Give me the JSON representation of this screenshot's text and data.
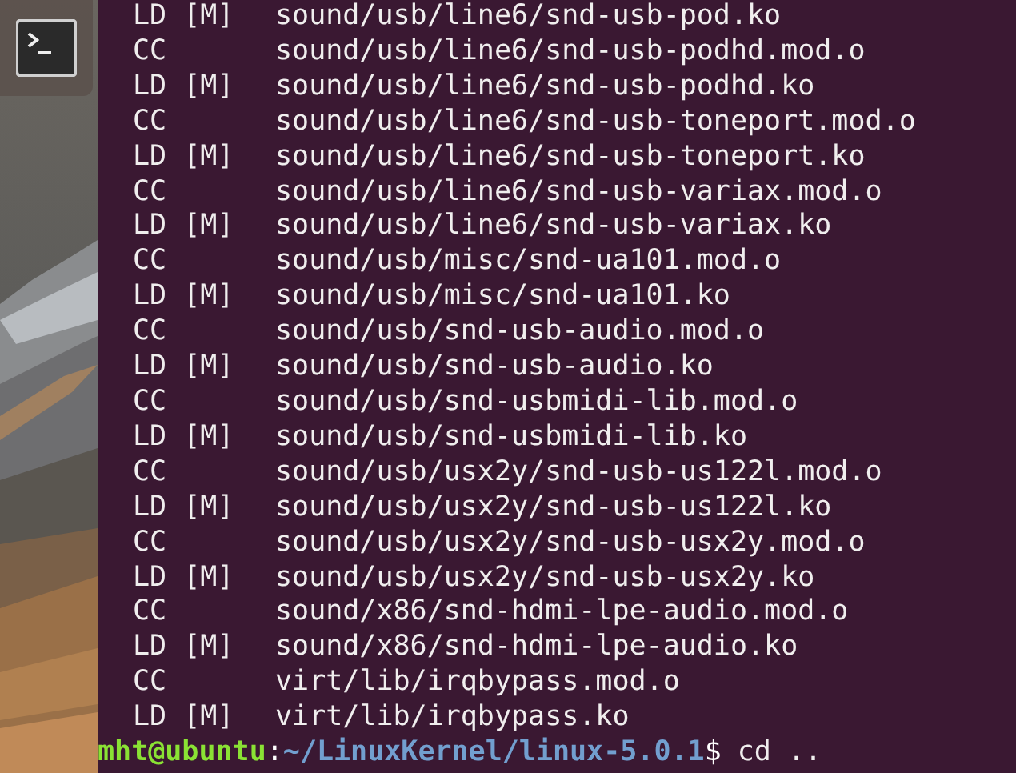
{
  "launcher": {
    "items": [
      {
        "kind": "terminal",
        "selected": true
      }
    ]
  },
  "terminal": {
    "lines": [
      {
        "tag": "LD [M]",
        "path": "sound/usb/line6/snd-usb-pod.ko"
      },
      {
        "tag": "CC",
        "path": "sound/usb/line6/snd-usb-podhd.mod.o"
      },
      {
        "tag": "LD [M]",
        "path": "sound/usb/line6/snd-usb-podhd.ko"
      },
      {
        "tag": "CC",
        "path": "sound/usb/line6/snd-usb-toneport.mod.o"
      },
      {
        "tag": "LD [M]",
        "path": "sound/usb/line6/snd-usb-toneport.ko"
      },
      {
        "tag": "CC",
        "path": "sound/usb/line6/snd-usb-variax.mod.o"
      },
      {
        "tag": "LD [M]",
        "path": "sound/usb/line6/snd-usb-variax.ko"
      },
      {
        "tag": "CC",
        "path": "sound/usb/misc/snd-ua101.mod.o"
      },
      {
        "tag": "LD [M]",
        "path": "sound/usb/misc/snd-ua101.ko"
      },
      {
        "tag": "CC",
        "path": "sound/usb/snd-usb-audio.mod.o"
      },
      {
        "tag": "LD [M]",
        "path": "sound/usb/snd-usb-audio.ko"
      },
      {
        "tag": "CC",
        "path": "sound/usb/snd-usbmidi-lib.mod.o"
      },
      {
        "tag": "LD [M]",
        "path": "sound/usb/snd-usbmidi-lib.ko"
      },
      {
        "tag": "CC",
        "path": "sound/usb/usx2y/snd-usb-us122l.mod.o"
      },
      {
        "tag": "LD [M]",
        "path": "sound/usb/usx2y/snd-usb-us122l.ko"
      },
      {
        "tag": "CC",
        "path": "sound/usb/usx2y/snd-usb-usx2y.mod.o"
      },
      {
        "tag": "LD [M]",
        "path": "sound/usb/usx2y/snd-usb-usx2y.ko"
      },
      {
        "tag": "CC",
        "path": "sound/x86/snd-hdmi-lpe-audio.mod.o"
      },
      {
        "tag": "LD [M]",
        "path": "sound/x86/snd-hdmi-lpe-audio.ko"
      },
      {
        "tag": "CC",
        "path": "virt/lib/irqbypass.mod.o"
      },
      {
        "tag": "LD [M]",
        "path": "virt/lib/irqbypass.ko"
      }
    ],
    "prompt": {
      "user": "mht@ubuntu",
      "separator": ":",
      "cwd": "~/LinuxKernel/linux-5.0.1",
      "symbol": "$",
      "command": "cd .."
    }
  }
}
